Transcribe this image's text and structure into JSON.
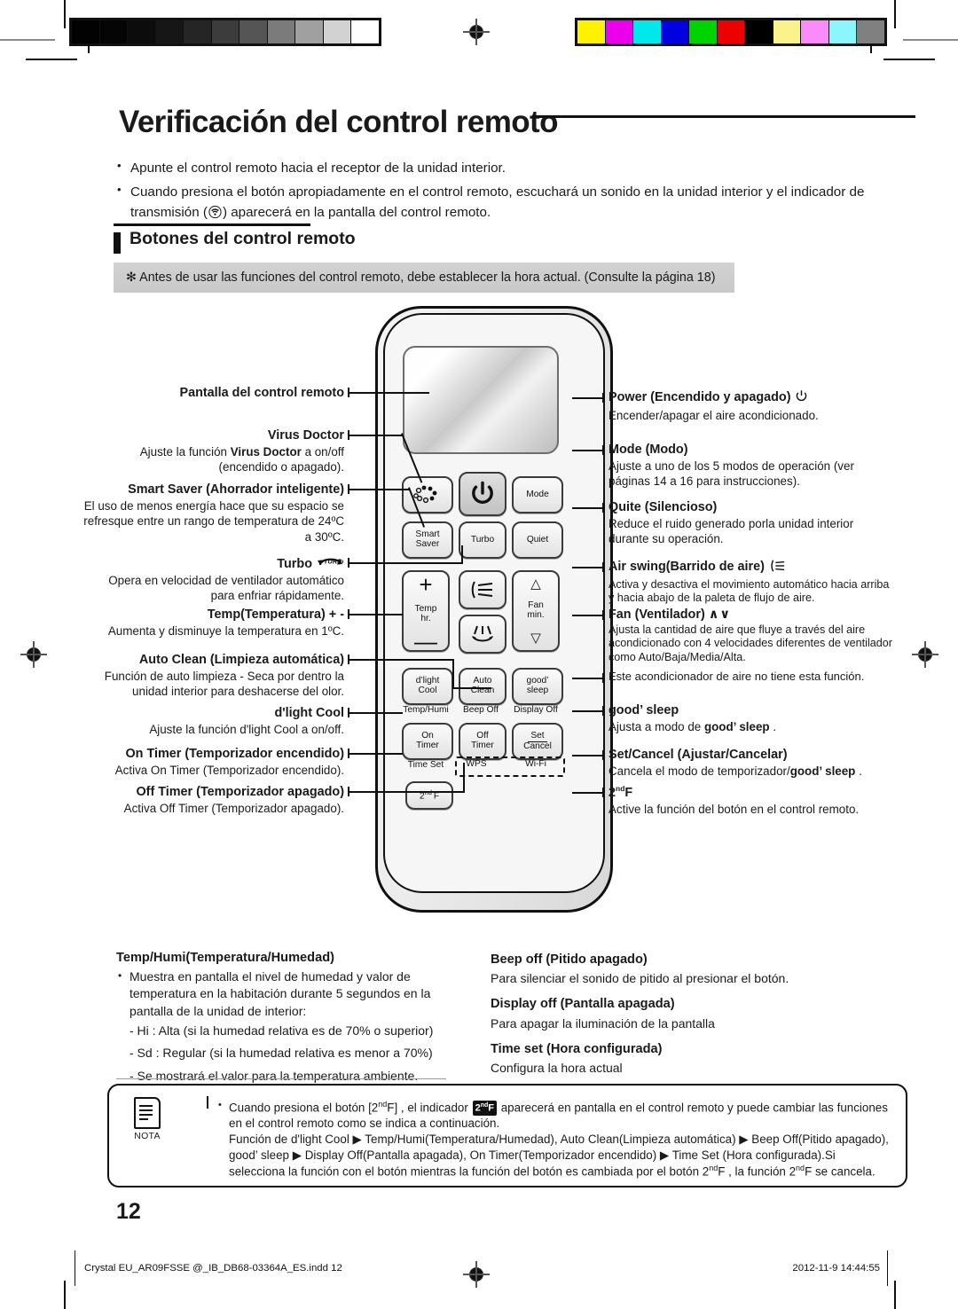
{
  "page": {
    "title": "Verificación del control remoto",
    "number": "12"
  },
  "intro": {
    "bullet1": "Apunte el control remoto hacia el receptor de la unidad interior.",
    "bullet2_a": "Cuando presiona el botón apropiadamente en el control remoto, escuchará un sonido en la unidad interior y el indicador de",
    "bullet2_b": "transmisión (",
    "bullet2_c": ") aparecerá en la pantalla del control remoto."
  },
  "section": {
    "heading": "Botones del control remoto",
    "note_bar": "✻ Antes de usar las funciones del control remoto, debe establecer la hora actual. (Consulte la página 18)"
  },
  "remote_buttons": {
    "virus_doctor": "",
    "power": "",
    "mode": "Mode",
    "smart_saver": "Smart\nSaver",
    "turbo": "Turbo",
    "quiet": "Quiet",
    "temp": "Temp\nhr.",
    "air_swing": "",
    "fan": "Fan\nmin.",
    "dlight_cool": "d'light\nCool",
    "auto_clean": "Auto\nClean",
    "good_sleep": "good’\nsleep",
    "on_timer": "On\nTimer",
    "off_timer": "Off\nTimer",
    "set_cancel_top": "Set",
    "set_cancel_bottom": "Cancel",
    "second_f": "2",
    "second_f_sup": "nd",
    "second_f_tail": "F",
    "sub_temp_humi": "Temp/Humi",
    "sub_beep_off": "Beep Off",
    "sub_display_off": "Display Off",
    "sub_time_set": "Time Set",
    "sub_wps": "WPS",
    "sub_wifi": "Wi-Fi"
  },
  "callouts_left": [
    {
      "heading": "Pantalla del control remoto",
      "desc": ""
    },
    {
      "heading": "Virus Doctor",
      "desc_pre": "Ajuste la función ",
      "desc_bold": "Virus Doctor",
      "desc_post": " a on/off (encendido o apagado)."
    },
    {
      "heading": "Smart Saver (Ahorrador inteligente)",
      "desc": "El uso de menos energía hace que su espacio se refresque entre un rango de temperatura de 24ºC a 30ºC."
    },
    {
      "heading": "Turbo",
      "desc": "Opera en velocidad de ventilador automático para enfriar rápidamente."
    },
    {
      "heading": "Temp(Temperatura) + -",
      "desc": "Aumenta y disminuye la temperatura en 1ºC."
    },
    {
      "heading": "Auto Clean (Limpieza automática)",
      "desc": "Función de auto limpieza - Seca por dentro la unidad interior para deshacerse del olor."
    },
    {
      "heading": "d'light Cool",
      "desc": "Ajuste la función d'light Cool a on/off."
    },
    {
      "heading": "On Timer (Temporizador encendido)",
      "desc": "Activa On Timer (Temporizador encendido)."
    },
    {
      "heading": "Off Timer (Temporizador apagado)",
      "desc": "Activa Off Timer (Temporizador apagado)."
    }
  ],
  "callouts_right": [
    {
      "heading": "Power (Encendido y apagado)",
      "desc": "Encender/apagar el aire acondicionado."
    },
    {
      "heading": "Mode (Modo)",
      "desc": "Ajuste a uno de los 5 modos de operación (ver páginas 14 a 16 para instrucciones)."
    },
    {
      "heading": "Quite (Silencioso)",
      "desc": "Reduce el ruido generado porla unidad interior durante su operación."
    },
    {
      "heading": "Air swing(Barrido de aire)",
      "desc": "Activa y desactiva el movimiento automático hacia arriba y hacia abajo de la paleta de flujo de aire."
    },
    {
      "heading": "Fan (Ventilador)",
      "desc": "Ajusta la cantidad de aire que fluye a través del aire acondicionado con 4 velocidades diferentes de ventilador como Auto/Baja/Media/Alta."
    },
    {
      "heading": "",
      "desc": "Este acondicionador de aire no tiene esta función."
    },
    {
      "heading": "good’ sleep",
      "desc_pre": "Ajusta a modo de ",
      "desc_bold": "good’ sleep",
      "desc_post": " ."
    },
    {
      "heading": "Set/Cancel (Ajustar/Cancelar)",
      "desc_pre": "Cancela el modo de temporizador/",
      "desc_bold": "good’ sleep",
      "desc_post": " ."
    },
    {
      "heading": "2ndF",
      "desc": "Active la función del botón en el control remoto."
    }
  ],
  "bottom_left": {
    "heading": "Temp/Humi(Temperatura/Humedad)",
    "bullet": "Muestra en pantalla el nivel de humedad y valor de temperatura en la habitación durante 5 segundos en la pantalla de la unidad de interior:",
    "sub1": "- Hi : Alta (si la humedad relativa es de 70% o superior)",
    "sub2": "- Sd : Regular (si la humedad relativa es menor a 70%)",
    "sub3": "- Se mostrará el valor para la temperatura ambiente."
  },
  "bottom_right": [
    {
      "heading": "Beep off (Pitido apagado)",
      "desc": "Para silenciar el sonido de pitido al presionar el botón."
    },
    {
      "heading": "Display off (Pantalla apagada)",
      "desc": "Para apagar la iluminación de la pantalla"
    },
    {
      "heading": "Time set (Hora configurada)",
      "desc": "Configura la hora actual"
    }
  ],
  "nota": {
    "label": "NOTA",
    "line1_a": "Cuando presiona el botón [2",
    "line1_sup": "nd",
    "line1_b": "F] , el indicador",
    "badge": "2ndF",
    "line1_c": "aparecerá en pantalla en el control remoto y puede cambiar las funciones en el control remoto como se indica a continuación.",
    "line2": "Función de d'light Cool ▶ Temp/Humi(Temperatura/Humedad), Auto Clean(Limpieza automática) ▶ Beep Off(Pitido apagado), good’ sleep ▶ Display Off(Pantalla apagada), On Timer(Temporizador encendido) ▶ Time Set (Hora configurada).Si selecciona la función con el botón mientras la función del botón es cambiada por el botón 2",
    "line2_sup": "nd",
    "line2_tail": "F , la función 2",
    "line2_sup2": "nd",
    "line2_tail2": "F se cancela."
  },
  "footer": {
    "left": "Crystal  EU_AR09FSSE @_IB_DB68-03364A_ES.indd   12",
    "right": "2012-11-9   14:44:55"
  },
  "calibration": {
    "grayscale": [
      "#020202",
      "#050505",
      "#0c0c0c",
      "#161616",
      "#252525",
      "#3c3c3c",
      "#555555",
      "#7b7b7b",
      "#a0a0a0",
      "#d2d2d2",
      "#ffffff"
    ],
    "colors": [
      "#fff200",
      "#ec00ec",
      "#00e8ec",
      "#0000e0",
      "#00d400",
      "#ec0000",
      "#000000",
      "#fcf28b",
      "#fb8bfb",
      "#8bf6fb",
      "#808080"
    ]
  }
}
